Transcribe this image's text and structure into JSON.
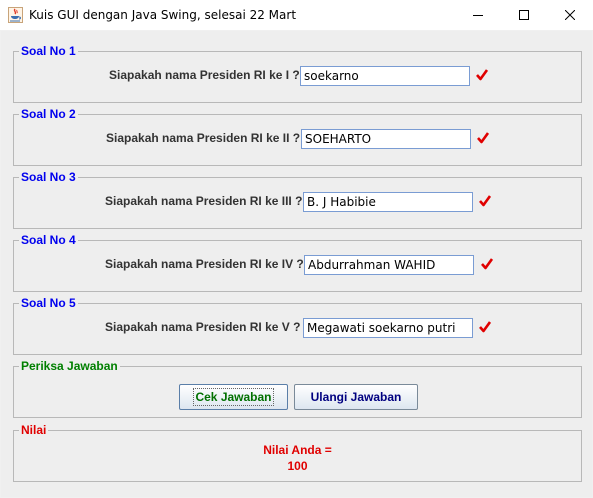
{
  "window": {
    "title": "Kuis GUI dengan Java Swing, selesai 22 Mart",
    "icon": "java-coffee-icon",
    "controls": [
      "minimize-icon",
      "maximize-icon",
      "close-icon"
    ]
  },
  "questions": [
    {
      "legend": "Soal No 1",
      "label": "Siapakah nama Presiden RI ke I ?",
      "answer": "soekarno",
      "status": "correct-check-icon"
    },
    {
      "legend": "Soal No 2",
      "label": "Siapakah nama Presiden RI ke II ?",
      "answer": "SOEHARTO",
      "status": "correct-check-icon"
    },
    {
      "legend": "Soal No 3",
      "label": "Siapakah nama Presiden RI ke III ?",
      "answer": "B. J Habibie",
      "status": "correct-check-icon"
    },
    {
      "legend": "Soal No 4",
      "label": "Siapakah nama Presiden RI ke IV ?",
      "answer": "Abdurrahman WAHID",
      "status": "correct-check-icon"
    },
    {
      "legend": "Soal No 5",
      "label": "Siapakah nama Presiden RI ke V ?",
      "answer": "Megawati soekarno putri",
      "status": "correct-check-icon"
    }
  ],
  "check_panel": {
    "legend": "Periksa Jawaban",
    "check_button": "Cek Jawaban",
    "reset_button": "Ulangi Jawaban"
  },
  "score_panel": {
    "legend": "Nilai",
    "label": "Nilai Anda =",
    "value": "100"
  },
  "colors": {
    "question_legend": "#0000ee",
    "check_legend": "#008000",
    "score_text": "#e00000",
    "checkmark": "#e00000"
  }
}
